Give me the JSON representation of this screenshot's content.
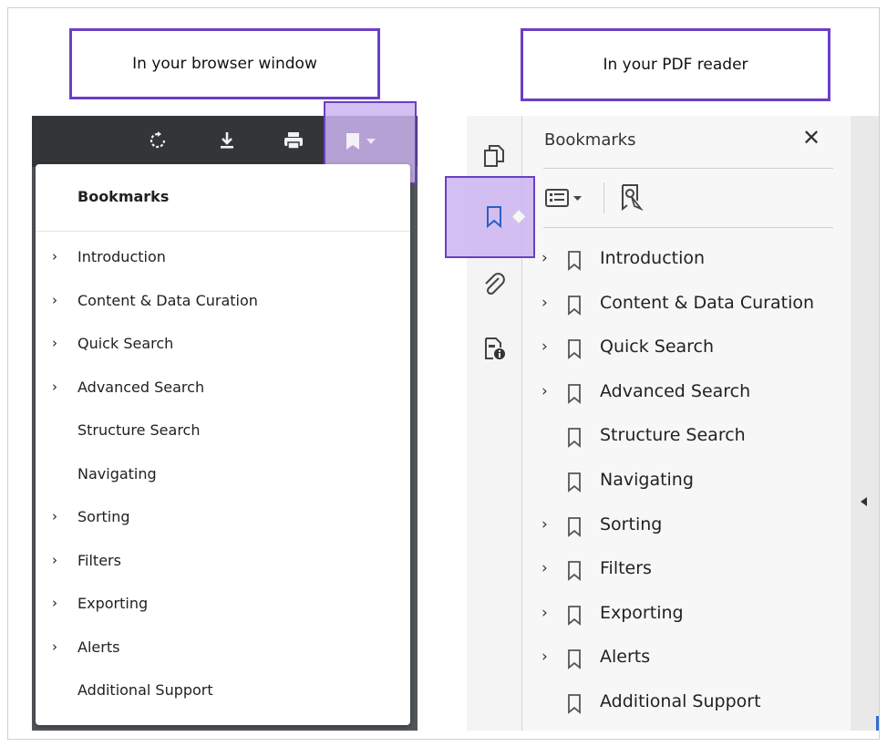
{
  "callouts": {
    "browser": "In your browser window",
    "pdf_reader": "In your PDF reader"
  },
  "browser": {
    "toolbar_icons": [
      "rotate-icon",
      "download-icon",
      "print-icon",
      "bookmark-icon",
      "caret-down-icon"
    ],
    "dropdown_title": "Bookmarks",
    "items": [
      {
        "label": "Introduction",
        "expandable": true
      },
      {
        "label": "Content & Data Curation",
        "expandable": true
      },
      {
        "label": "Quick Search",
        "expandable": true
      },
      {
        "label": "Advanced Search",
        "expandable": true
      },
      {
        "label": "Structure Search",
        "expandable": false
      },
      {
        "label": "Navigating",
        "expandable": false
      },
      {
        "label": "Sorting",
        "expandable": true
      },
      {
        "label": "Filters",
        "expandable": true
      },
      {
        "label": "Exporting",
        "expandable": true
      },
      {
        "label": "Alerts",
        "expandable": true
      },
      {
        "label": "Additional Support",
        "expandable": false
      }
    ],
    "chevron": "›"
  },
  "pdf": {
    "rail_icons": [
      "pages-icon",
      "bookmark-icon",
      "attachment-icon",
      "document-info-icon"
    ],
    "panel_title": "Bookmarks",
    "close_glyph": "✕",
    "items": [
      {
        "label": "Introduction",
        "expandable": true
      },
      {
        "label": "Content & Data Curation",
        "expandable": true
      },
      {
        "label": "Quick Search",
        "expandable": true
      },
      {
        "label": "Advanced Search",
        "expandable": true
      },
      {
        "label": "Structure Search",
        "expandable": false
      },
      {
        "label": "Navigating",
        "expandable": false
      },
      {
        "label": "Sorting",
        "expandable": true
      },
      {
        "label": "Filters",
        "expandable": true
      },
      {
        "label": "Exporting",
        "expandable": true
      },
      {
        "label": "Alerts",
        "expandable": true
      },
      {
        "label": "Additional Support",
        "expandable": false
      }
    ],
    "chevron": "›"
  },
  "colors": {
    "highlight_border": "#6b3fc6",
    "highlight_fill": "#cdb4f0",
    "browser_toolbar": "#323639",
    "browser_body": "#525659"
  }
}
